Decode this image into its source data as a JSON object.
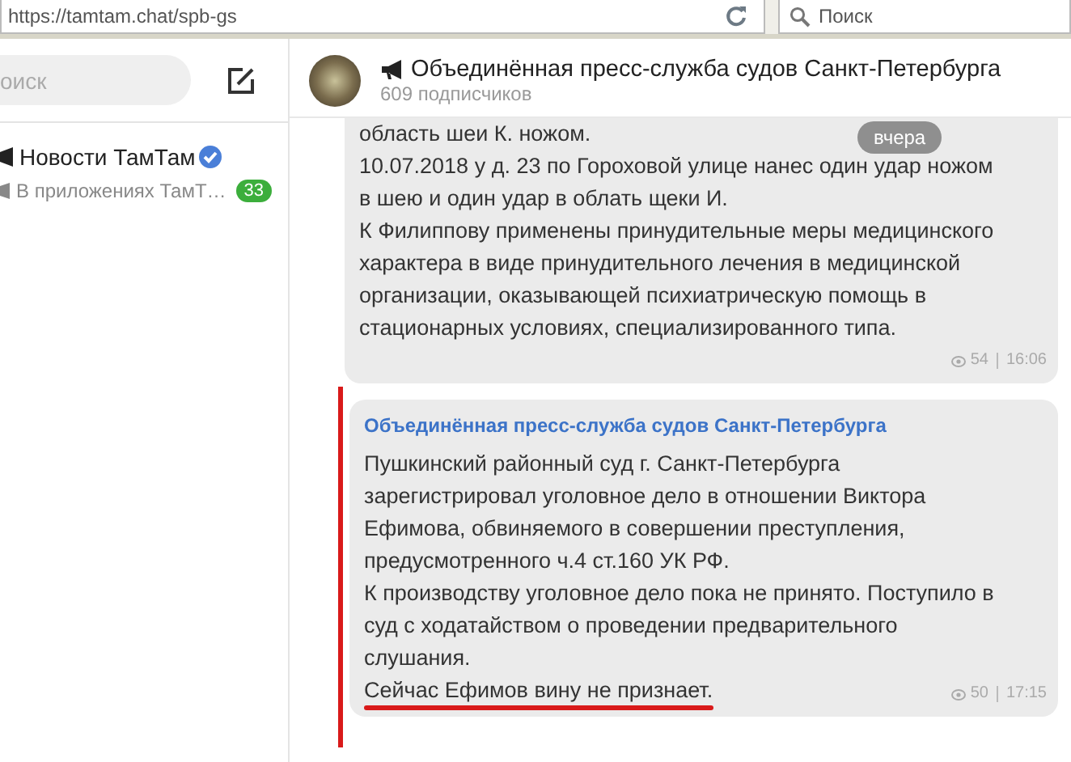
{
  "browser": {
    "url": "https://tamtam.chat/spb-gs",
    "search": {
      "placeholder": "Поиск"
    }
  },
  "sidebar": {
    "search": {
      "placeholder": "оиск"
    },
    "chats": [
      {
        "title": "Новости ТамТам",
        "verified": true,
        "preview": "В приложениях ТамТ…",
        "unread": "33",
        "selected": false
      }
    ]
  },
  "channel": {
    "title": "Объединённая пресс-служба судов Санкт-Петербурга",
    "subscribers": "609 подписчиков"
  },
  "date_pill": "вчера",
  "messages": [
    {
      "highlighted": false,
      "paragraphs": [
        "область шеи К. ножом.",
        "10.07.2018 у д. 23 по Гороховой улице нанес один удар ножом в шею и один удар в облать щеки И.",
        "К Филиппову применены принудительные меры медицинского характера в виде принудительного лечения в медицинской организации, оказывающей психиатрическую помощь в стационарных условиях, специализированного типа."
      ],
      "views": "54",
      "time": "16:06"
    },
    {
      "author": "Объединённая пресс-служба судов Санкт-Петербурга",
      "highlighted": true,
      "paragraphs": [
        "Пушкинский районный суд г. Санкт-Петербурга зарегистрировал уголовное дело в отношении Виктора Ефимова, обвиняемого в совершении преступления, предусмотренного ч.4 ст.160 УК РФ.",
        "К производству уголовное дело пока не принято. Поступило в суд с ходатайством о проведении предварительного слушания.",
        "Сейчас Ефимов вину не признает."
      ],
      "views": "50",
      "time": "17:15"
    }
  ]
}
